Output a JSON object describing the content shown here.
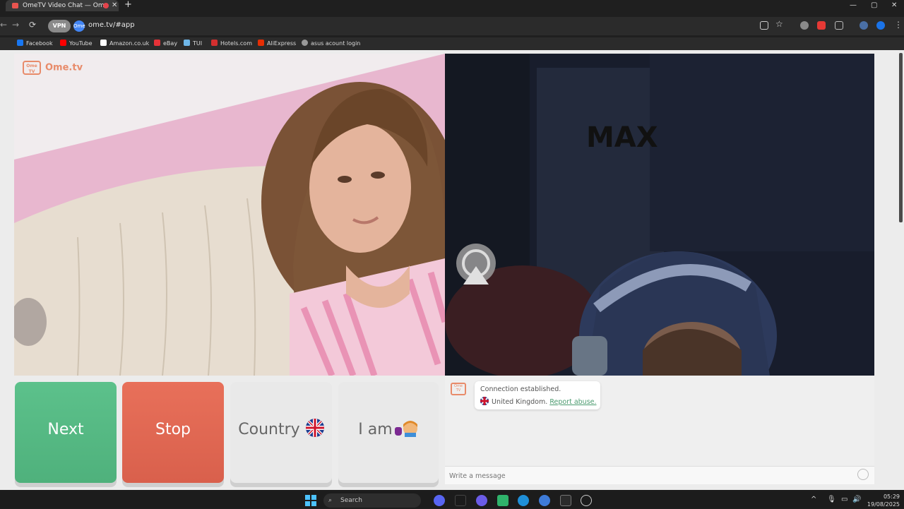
{
  "browser": {
    "tab_title": "OmeTV Video Chat — Ome",
    "url": "ome.tv/#app",
    "vpn_label": "VPN",
    "site_badge": "Ome",
    "bookmarks": [
      {
        "label": "Facebook",
        "icon": "facebook-icon",
        "color": "#1877f2"
      },
      {
        "label": "YouTube",
        "icon": "youtube-icon",
        "color": "#ff0000"
      },
      {
        "label": "Amazon.co.uk",
        "icon": "amazon-icon",
        "color": "#ffffff"
      },
      {
        "label": "eBay",
        "icon": "ebay-icon",
        "color": "#e53238"
      },
      {
        "label": "TUI",
        "icon": "tui-icon",
        "color": "#6fb7e9"
      },
      {
        "label": "Hotels.com",
        "icon": "hotels-icon",
        "color": "#d32f2f"
      },
      {
        "label": "AliExpress",
        "icon": "aliexpress-icon",
        "color": "#e62e04"
      },
      {
        "label": "asus acount login",
        "icon": "globe-icon",
        "color": "#999999"
      }
    ]
  },
  "app": {
    "logo_text": "Ome.tv",
    "logo_icon_text": "Ome TV",
    "buttons": {
      "next": "Next",
      "stop": "Stop",
      "country": "Country",
      "iam": "I am"
    },
    "chat": {
      "connection": "Connection established.",
      "country": "United Kingdom.",
      "report": "Report abuse.",
      "input_placeholder": "Write a message"
    },
    "overlay_text": "MAX"
  },
  "taskbar": {
    "search": "Search",
    "time": "05:29",
    "date": "19/08/2025"
  },
  "colors": {
    "next": "#5cc18b",
    "stop": "#e8705a",
    "brand": "#e88b6a"
  }
}
